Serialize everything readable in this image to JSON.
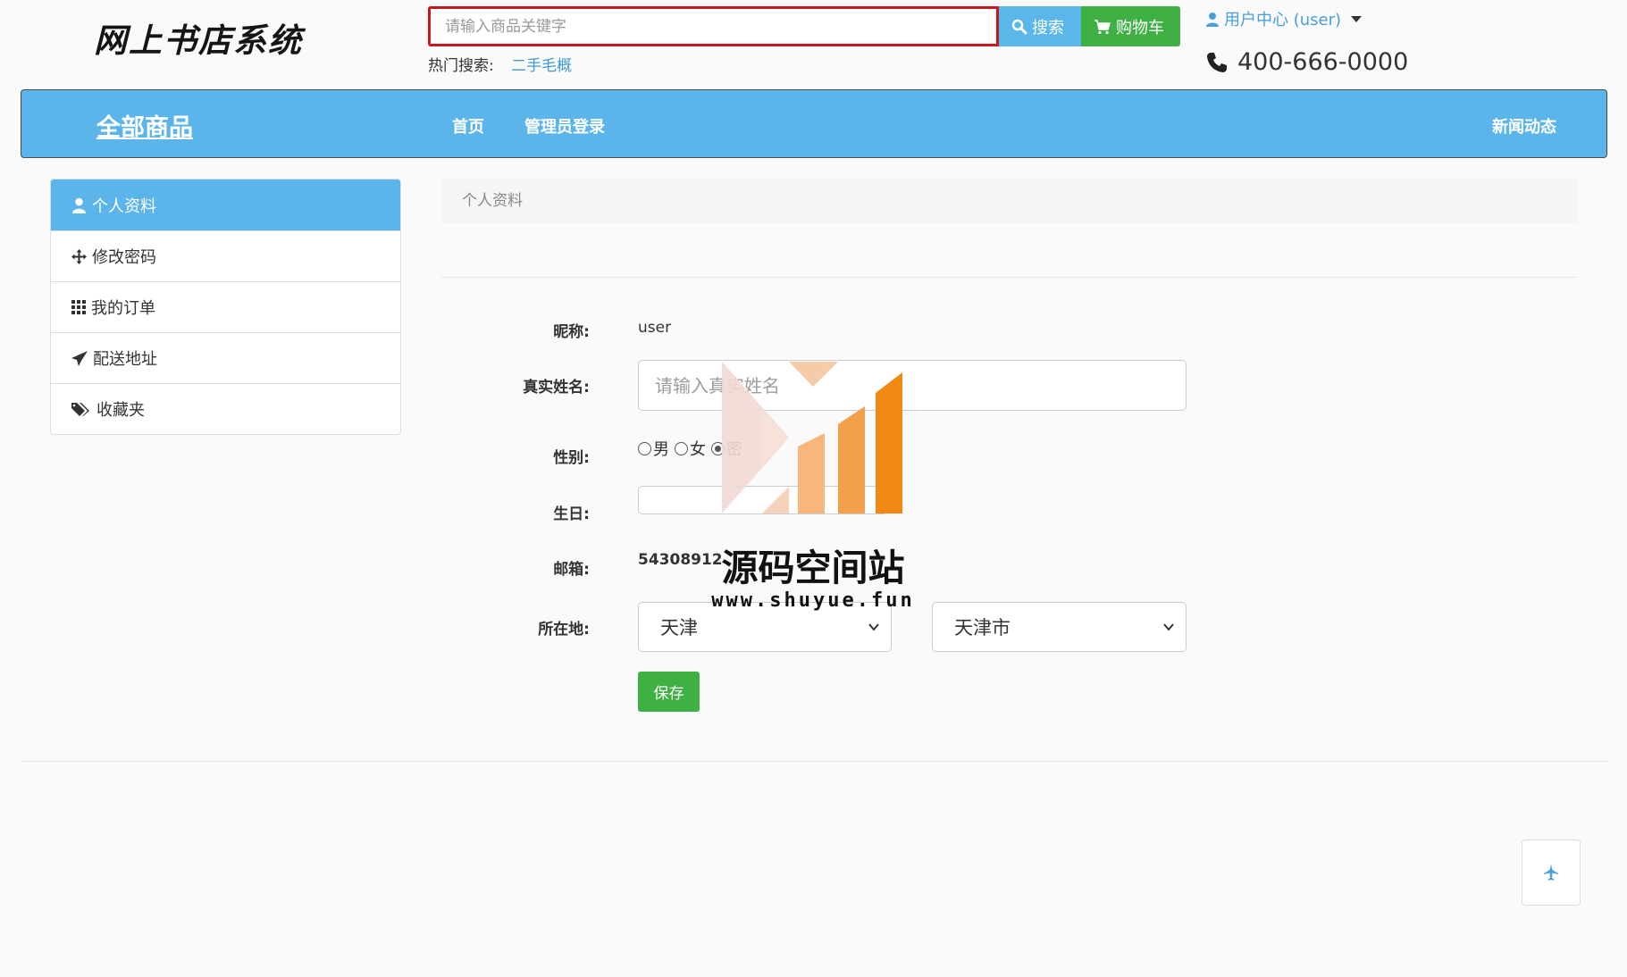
{
  "header": {
    "logo_text": "网上书店系统",
    "search": {
      "placeholder": "请输入商品关键字"
    },
    "search_button": "搜索",
    "cart_button": "购物车",
    "hot_search_label": "热门搜索:",
    "hot_search_items": [
      "二手毛概"
    ],
    "user_center": "用户中心 (user)",
    "phone": "400-666-0000"
  },
  "navbar": {
    "brand": "全部商品",
    "links": [
      "首页",
      "管理员登录"
    ],
    "right_link": "新闻动态"
  },
  "sidebar": {
    "items": [
      {
        "label": "个人资料",
        "icon": "user-icon",
        "active": true
      },
      {
        "label": "修改密码",
        "icon": "move-icon",
        "active": false
      },
      {
        "label": "我的订单",
        "icon": "grid-icon",
        "active": false
      },
      {
        "label": "配送地址",
        "icon": "send-icon",
        "active": false
      },
      {
        "label": "收藏夹",
        "icon": "tags-icon",
        "active": false
      }
    ]
  },
  "main": {
    "breadcrumb": "个人资料",
    "form": {
      "nickname_label": "昵称:",
      "nickname_value": "user",
      "realname_label": "真实姓名:",
      "realname_placeholder": "请输入真实姓名",
      "gender_label": "性别:",
      "gender_options": [
        "男",
        "女",
        "密"
      ],
      "gender_selected": "密",
      "birthday_label": "生日:",
      "email_label": "邮箱:",
      "email_value": "54308912",
      "location_label": "所在地:",
      "province": "天津",
      "city": "天津市",
      "save_button": "保存"
    }
  },
  "watermark": {
    "title": "源码空间站",
    "url": "www.shuyue.fun"
  },
  "colors": {
    "primary": "#5bb5ea",
    "success": "#3fb044",
    "search_border": "#c8161e",
    "link": "#3d9ad8"
  }
}
